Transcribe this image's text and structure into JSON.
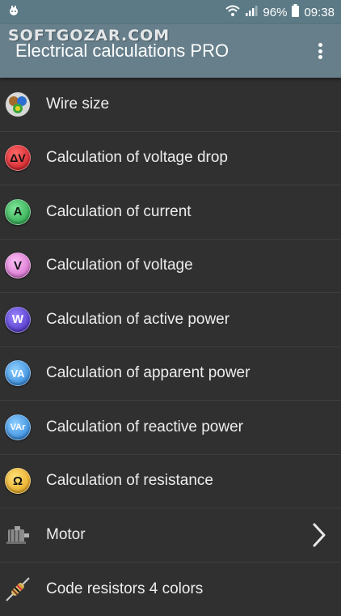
{
  "status": {
    "battery": "96%",
    "time": "09:38"
  },
  "watermark": "SOFTGOZAR.COM",
  "app": {
    "title": "Electrical calculations PRO"
  },
  "items": [
    {
      "label": "Wire size",
      "icon": "wire-colors-icon"
    },
    {
      "label": "Calculation of voltage drop",
      "icon": "voltage-drop-icon",
      "glyph": "ΔV",
      "color": "#e0242f"
    },
    {
      "label": "Calculation of current",
      "icon": "current-icon",
      "glyph": "A",
      "color": "#27b34a"
    },
    {
      "label": "Calculation of voltage",
      "icon": "voltage-icon",
      "glyph": "V",
      "color": "#e27ad8"
    },
    {
      "label": "Calculation of active power",
      "icon": "active-power-icon",
      "glyph": "W",
      "color": "#5a3fd6"
    },
    {
      "label": "Calculation of apparent power",
      "icon": "apparent-power-icon",
      "glyph": "VA",
      "color": "#2f8fe6"
    },
    {
      "label": "Calculation of reactive power",
      "icon": "reactive-power-icon",
      "glyph": "VAr",
      "color": "#2f8fe6"
    },
    {
      "label": "Calculation of resistance",
      "icon": "resistance-icon",
      "glyph": "Ω",
      "color": "#f5b81e"
    },
    {
      "label": "Motor",
      "icon": "motor-icon"
    },
    {
      "label": "Code resistors 4 colors",
      "icon": "resistor-icon"
    }
  ]
}
